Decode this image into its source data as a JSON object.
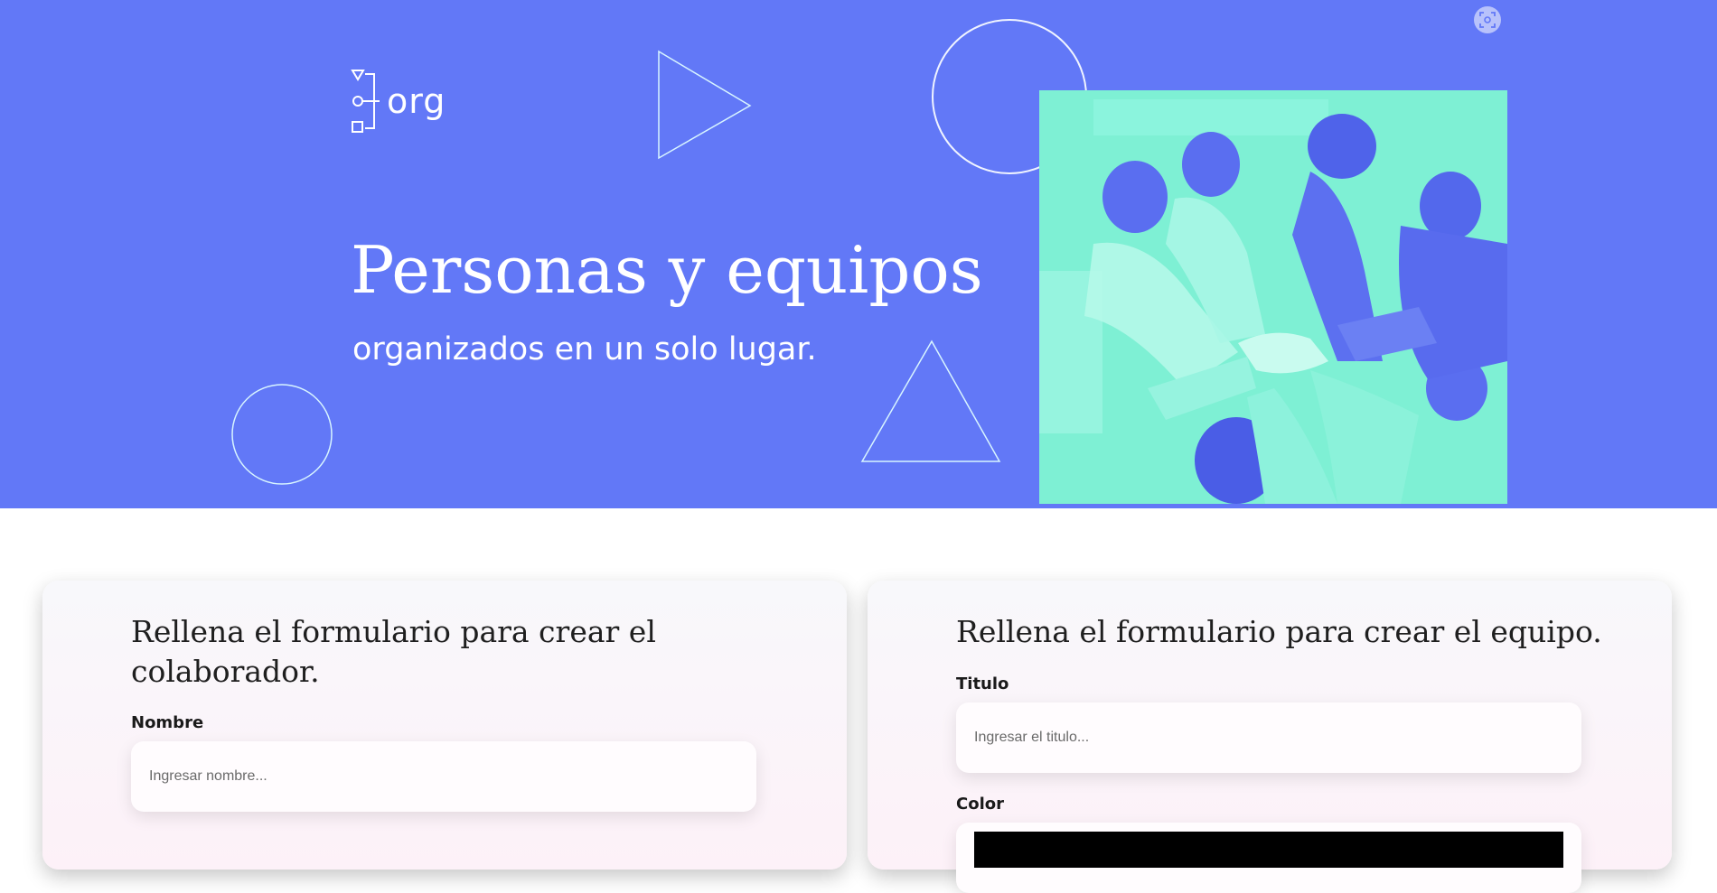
{
  "header": {
    "brand": "org",
    "title": "Personas y equipos",
    "subtitle": "organizados en un solo lugar.",
    "background_color": "#6278f7",
    "photo_tint": "#7ef0d4",
    "photo_alt": "Equipo de personas uniendo sus manos",
    "screenshot_button_label": "Captura de pantalla"
  },
  "collaborator_form": {
    "heading": "Rellena el formulario para crear el colaborador.",
    "name_label": "Nombre",
    "name_placeholder": "Ingresar nombre...",
    "name_value": ""
  },
  "team_form": {
    "heading": "Rellena el formulario para crear el equipo.",
    "title_label": "Titulo",
    "title_placeholder": "Ingresar el titulo...",
    "title_value": "",
    "color_label": "Color",
    "color_value": "#000000"
  },
  "icons": {
    "logo": "org-logo-icon",
    "screenshot": "screenshot-icon"
  }
}
